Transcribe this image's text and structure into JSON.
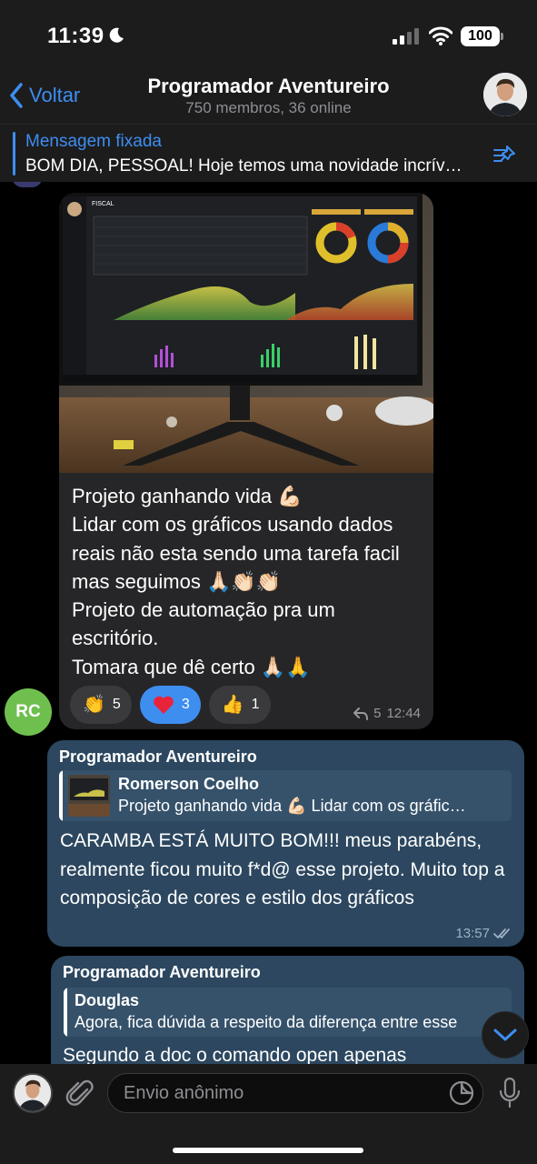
{
  "status_bar": {
    "time": "11:39",
    "battery": "100"
  },
  "header": {
    "back_label": "Voltar",
    "title": "Programador Aventureiro",
    "subtitle": "750 membros, 36 online"
  },
  "pinned": {
    "title": "Mensagem fixada",
    "text": "BOM DIA, PESSOAL! Hoje temos uma novidade incrív…"
  },
  "photo_screen": {
    "title": "FISCAL"
  },
  "messages": [
    {
      "sender_initials": "RC",
      "lines": [
        "Projeto ganhando vida 💪🏻",
        "Lidar com os gráficos usando dados",
        "reais não esta sendo uma tarefa facil",
        "mas seguimos 🙏🏻👏🏻👏🏻",
        "Projeto de automação pra um",
        "escritório.",
        "Tomara que dê certo 🙏🏻🙏"
      ],
      "reactions": [
        {
          "emoji": "👏",
          "count": "5"
        },
        {
          "emoji": "❤️",
          "count": "3"
        },
        {
          "emoji": "👍",
          "count": "1"
        }
      ],
      "replies": "5",
      "time": "12:44"
    },
    {
      "sender": "Programador Aventureiro",
      "reply_to_name": "Romerson Coelho",
      "reply_to_text": "Projeto ganhando vida 💪🏻 Lidar com os gráfic…",
      "text": "CARAMBA ESTÁ MUITO BOM!!! meus parabéns, realmente ficou muito f*d@ esse projeto. Muito top a composição de cores e estilo dos gráficos",
      "time": "13:57"
    },
    {
      "sender": "Programador Aventureiro",
      "reply_to_name": "Douglas",
      "reply_to_text": "Agora, fica dúvida a respeito da diferença entre esse",
      "text": "Segundo a doc o comando open apenas"
    }
  ],
  "input": {
    "placeholder": "Envio anônimo"
  },
  "colors": {
    "accent": "#3e8ef0",
    "outgoing_bubble": "#2c475f",
    "incoming_bubble": "#262628",
    "avatar_rc": "#6fbf4f"
  },
  "icons": [
    "moon-icon",
    "signal-icon",
    "wifi-icon",
    "chevron-left-icon",
    "pin-icon",
    "heart-icon",
    "reply-arrow-icon",
    "double-check-icon",
    "chevron-down-icon",
    "paperclip-icon",
    "sticker-icon",
    "microphone-icon"
  ]
}
